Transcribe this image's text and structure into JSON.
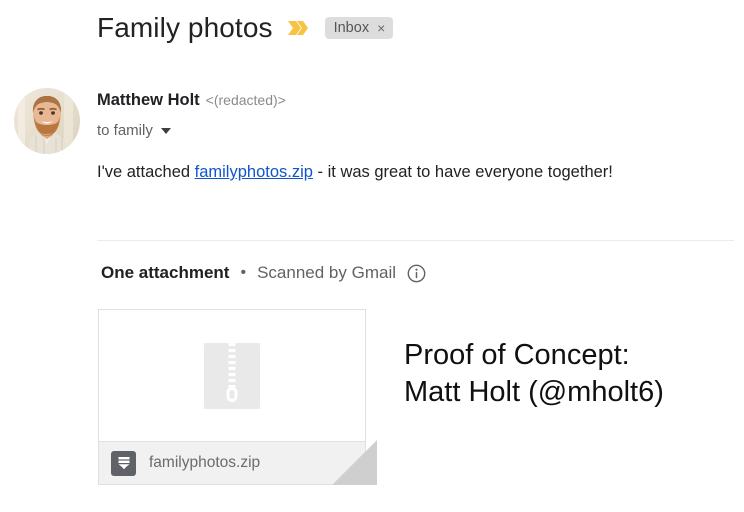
{
  "subject": {
    "title": "Family photos",
    "important_marker_icon": "double-chevron-important-icon",
    "important_marker_color": "#f7c343",
    "label_chip": {
      "text": "Inbox",
      "close_glyph": "×",
      "background": "#ddddde"
    }
  },
  "sender": {
    "avatar_icon": "sender-avatar-photo",
    "name": "Matthew Holt",
    "email": "<(redacted)>",
    "recipient": "to family",
    "expand_icon": "caret-down-icon"
  },
  "body": {
    "before_link": "I've attached ",
    "link_text": "familyphotos.zip",
    "link_color": "#1155cc",
    "after_link": " - it was great to have everyone together!"
  },
  "attachments": {
    "count_label": "One attachment",
    "separator": "•",
    "scan_label": "Scanned by Gmail",
    "info_icon": "info-circle-icon",
    "card": {
      "thumbnail_icon": "zip-file-thumbnail-icon",
      "file_icon": "zip-archive-icon",
      "file_name": "familyphotos.zip",
      "footer_background": "#f1f1f1",
      "corner_fold_color": "#cfcfcf"
    }
  },
  "overlay": {
    "line1": "Proof of Concept:",
    "line2": "Matt Holt (@mholt6)"
  }
}
